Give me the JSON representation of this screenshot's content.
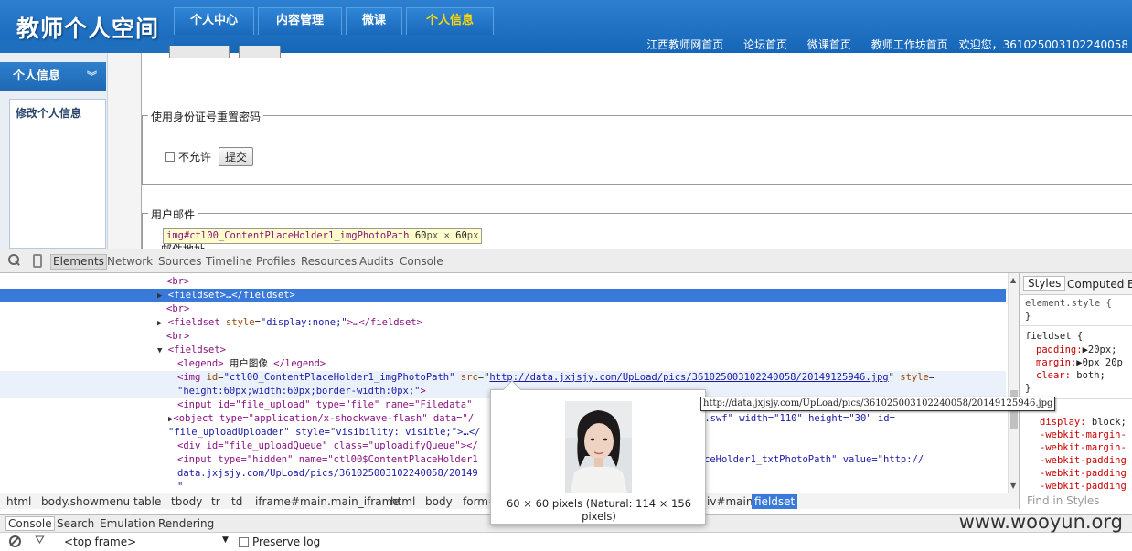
{
  "site": {
    "logo": "教师个人空间",
    "nav_tabs": [
      "个人中心",
      "内容管理",
      "微课",
      "个人信息"
    ],
    "top_links": [
      "江西教师网首页",
      "论坛首页",
      "微课首页",
      "教师工作坊首页"
    ],
    "welcome": "欢迎您，361025003102240058",
    "sidebar_title": "个人信息",
    "sidebar_item": "修改个人信息",
    "fieldset_reset": {
      "legend": "使用身份证号重置密码",
      "checkbox_label": "不允许",
      "submit_label": "提交"
    },
    "fieldset_email": {
      "legend": "用户邮件",
      "partial_label": "邮件地址"
    },
    "highlight_tooltip": {
      "selector": "img#ctl00_ContentPlaceHolder1_imgPhotoPath",
      "width": "60",
      "height": "60",
      "unit": "px",
      "times": "×"
    }
  },
  "devtools": {
    "tabs": [
      "Elements",
      "Network",
      "Sources",
      "Timeline",
      "Profiles",
      "Resources",
      "Audits",
      "Console"
    ],
    "selected_tab": "Elements",
    "dom_lines": {
      "l1": "<br>",
      "l2_tag": "<fieldset>",
      "l2_ell": "…",
      "l2_close": "</fieldset>",
      "l3": "<br>",
      "l4_open": "<fieldset ",
      "l4_attr": "style",
      "l4_val": "\"display:none;\"",
      "l4_rest": ">…</fieldset>",
      "l5": "<br>",
      "l6": "<fieldset>",
      "l7_open": "<legend>",
      "l7_text": " 用户图像 ",
      "l7_close": "</legend>",
      "l8_open": "<img ",
      "l8_id_attr": "id",
      "l8_id_val": "\"ctl00_ContentPlaceHolder1_imgPhotoPath\"",
      "l8_src_attr": "src",
      "l8_src_val": "http://data.jxjsjy.com/UpLoad/pics/361025003102240058/20149125946.jpg",
      "l8_style_attr": "style",
      "l9_style_val": "\"height:60px;width:60px;border-width:0px;\"",
      "l9_close": ">",
      "l10": "<input id=\"file_upload\" type=\"file\" name=\"Filedata\"",
      "l11_a": "<object type=\"application/x-shockwave-flash\" data=\"/",
      "l11_b": "y.swf\" width=\"110\" height=\"30\" id=",
      "l12": "\"file_uploadUploader\" style=\"visibility: visible;\">…</",
      "l13": "<div id=\"file_uploadQueue\" class=\"uploadifyQueue\"></",
      "l14_a": "<input type=\"hidden\" name=\"ctl00$ContentPlaceHolder1",
      "l14_b": "ceHolder1_txtPhotoPath\" value=\"http://",
      "l15": "data.jxjsjy.com/UpLoad/pics/361025003102240058/20149",
      "l16": "\""
    },
    "styles": {
      "tabs": [
        "Styles",
        "Computed",
        "E"
      ],
      "rule1_selector": "element.style {",
      "rule1_close": "}",
      "rule2_selector": "fieldset {",
      "padding": "padding:",
      "padding_val": "▶20px;",
      "margin": "margin:",
      "margin_val": "▶0px 20p",
      "clear": "clear:",
      "clear_val": "both;",
      "rule2_close": "}",
      "display": "display:",
      "display_val": "block;",
      "wk1": "-webkit-margin-",
      "wk2": "-webkit-margin-",
      "wk3": "-webkit-padding",
      "wk4": "-webkit-padding",
      "wk5": "-webkit-padding"
    },
    "breadcrumbs": [
      "html",
      "body.showmenu",
      "table",
      "tbody",
      "tr",
      "td",
      "iframe#main.main_iframe",
      "html",
      "body",
      "form#",
      "iv#main",
      "fieldset"
    ],
    "find_placeholder": "Find in Styles",
    "drawer_tabs": [
      "Console",
      "Search",
      "Emulation",
      "Rendering"
    ],
    "frame_select": "<top frame>",
    "preserve_log": "Preserve log",
    "image_popup_caption": "60 × 60 pixels (Natural: 114 × 156 pixels)",
    "url_tooltip": "http://data.jxjsjy.com/UpLoad/pics/361025003102240058/20149125946.jpg"
  },
  "watermark": "www.wooyun.org"
}
